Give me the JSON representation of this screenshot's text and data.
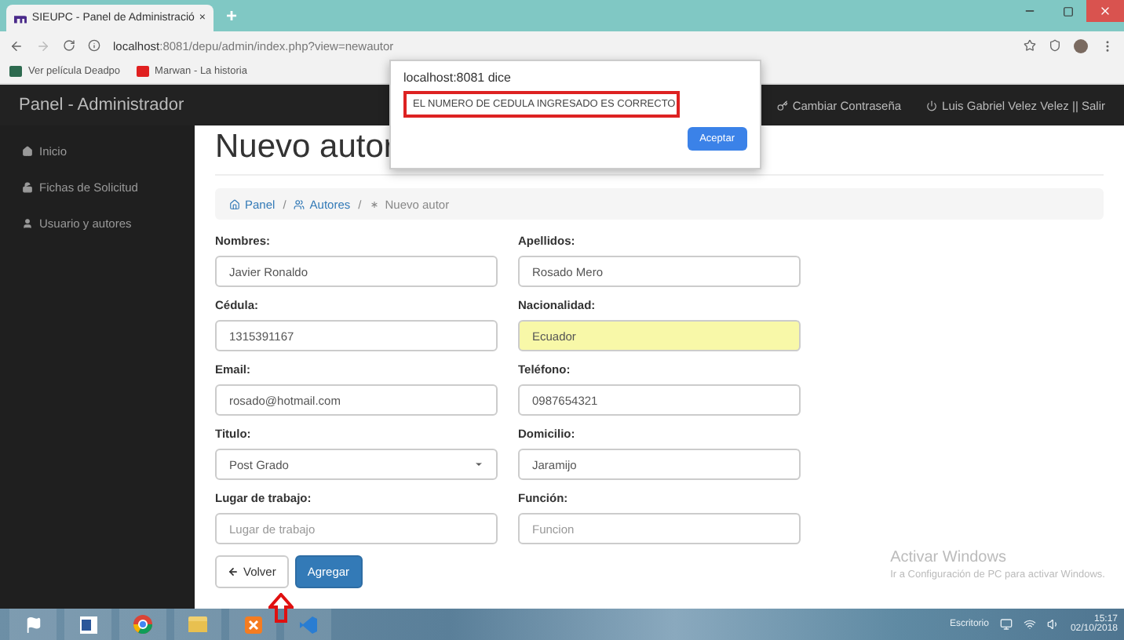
{
  "browser": {
    "tab_title": "SIEUPC - Panel de Administració",
    "tab_close": "×",
    "new_tab": "+",
    "address_host": "localhost",
    "address_rest": ":8081/depu/admin/index.php?view=newautor",
    "bookmarks": [
      "Ver película Deadpo",
      "Marwan - La historia"
    ]
  },
  "dialog": {
    "title": "localhost:8081 dice",
    "message": "EL NUMERO DE CEDULA INGRESADO ES CORRECTO",
    "button": "Aceptar"
  },
  "navbar": {
    "brand": "Panel - Administrador",
    "links": [
      "Cambiar Contraseña",
      "Luis Gabriel Velez Velez || Salir"
    ]
  },
  "sidebar": {
    "items": [
      "Inicio",
      "Fichas de Solicitud",
      "Usuario y autores"
    ]
  },
  "page": {
    "heading": "Nuevo autor",
    "breadcrumb": [
      "Panel",
      "Autores",
      "Nuevo autor"
    ],
    "breadcrumb_separator": "/",
    "fields": [
      {
        "label": "Nombres:",
        "kind": "text",
        "value": "Javier Ronaldo",
        "highlighted": false
      },
      {
        "label": "Apellidos:",
        "kind": "text",
        "value": "Rosado Mero",
        "highlighted": false
      },
      {
        "label": "Cédula:",
        "kind": "text",
        "value": "1315391167",
        "highlighted": false
      },
      {
        "label": "Nacionalidad:",
        "kind": "text",
        "value": "Ecuador",
        "highlighted": true
      },
      {
        "label": "Email:",
        "kind": "text",
        "value": "rosado@hotmail.com",
        "highlighted": false
      },
      {
        "label": "Teléfono:",
        "kind": "text",
        "value": "0987654321",
        "highlighted": false
      },
      {
        "label": "Titulo:",
        "kind": "select",
        "value": "Post Grado",
        "highlighted": false
      },
      {
        "label": "Domicilio:",
        "kind": "text",
        "value": "Jaramijo",
        "highlighted": false
      },
      {
        "label": "Lugar de trabajo:",
        "kind": "text",
        "placeholder": "Lugar de trabajo",
        "highlighted": false
      },
      {
        "label": "Función:",
        "kind": "text",
        "placeholder": "Funcion",
        "highlighted": false
      }
    ],
    "buttons": [
      {
        "label": "Volver",
        "kind": "back"
      },
      {
        "label": "Agregar",
        "kind": "primary"
      }
    ]
  },
  "activation_notice": {
    "title": "Activar Windows",
    "text": "Ir a Configuración de PC para activar Windows."
  },
  "taskbar": {
    "desktop_label": "Escritorio",
    "time": "15:17",
    "date": "02/10/2018"
  }
}
